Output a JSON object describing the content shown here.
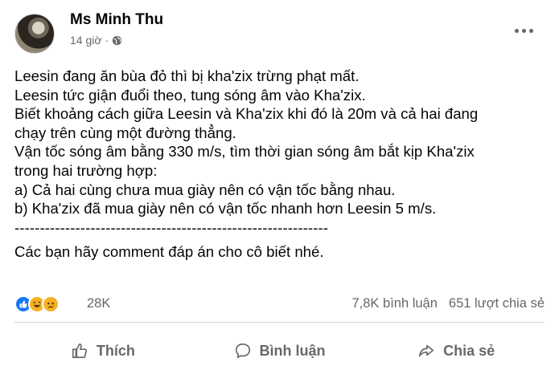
{
  "post": {
    "author": "Ms Minh Thu",
    "time": "14 giờ",
    "dot": "·",
    "privacy_icon": "globe-icon",
    "more_icon": "more-options-icon",
    "lines": [
      "Leesin đang ăn bùa đỏ thì bị kha'zix trừng phạt mất.",
      "Leesin tức giận đuổi theo, tung sóng âm vào Kha'zix.",
      "Biết khoảng cách giữa Leesin và Kha'zix khi đó là 20m và cả hai đang",
      "chạy trên cùng một đường thẳng.",
      "Vận tốc sóng âm bằng 330 m/s, tìm thời gian sóng âm bắt kịp Kha'zix",
      "trong hai trường hợp:",
      "a) Cả hai cùng chưa mua giày nên có vận tốc bằng nhau.",
      "b) Kha'zix đã mua giày nên có vận tốc nhanh hơn Leesin 5 m/s.",
      "--------------------------------------------------------------",
      "Các bạn hãy comment đáp án cho cô biết nhé."
    ]
  },
  "stats": {
    "reactions": [
      "like-icon",
      "haha-icon",
      "sad-icon"
    ],
    "reaction_count": "28K",
    "comments": "7,8K bình luận",
    "shares": "651 lượt chia sẻ"
  },
  "actions": {
    "like": "Thích",
    "comment": "Bình luận",
    "share": "Chia sẻ"
  },
  "colors": {
    "text": "#050505",
    "secondary": "#65676b",
    "like_blue": "#1877f2",
    "reaction_yellow": "#f7b125"
  }
}
